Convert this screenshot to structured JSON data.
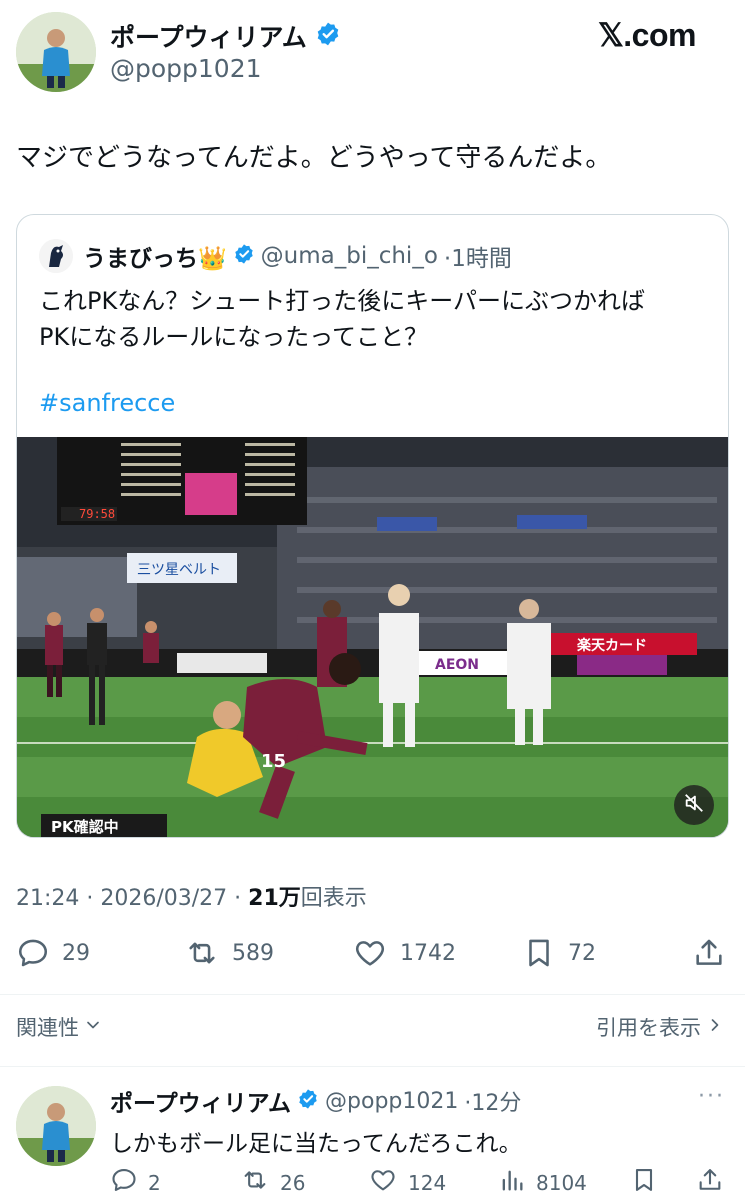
{
  "brand": {
    "site": "𝕏.com"
  },
  "main_tweet": {
    "author_name": "ポープウィリアム",
    "author_handle": "@popp1021",
    "text": "マジでどうなってんだよ。どうやって守るんだよ。",
    "time": "21:24 · 2026/03/27 · ",
    "views_count": "21万",
    "views_label": "回表示"
  },
  "quoted_tweet": {
    "author_name": "うまびっち👑",
    "author_handle": "@uma_bi_chi_o",
    "time": "·1時間",
    "text_line1": "これPKなん？シュート打った後にキーパーにぶつかれば",
    "text_line2": "PKになるルールになったってこと？",
    "hashtag": "#sanfrecce",
    "media": {
      "overlay_label": "PK確認中",
      "scoreboard_time": "79:58",
      "ad_banner": "三ツ星ベルト",
      "ad_right": "楽天カード",
      "ad_aeon": "AEON",
      "player_number": "15"
    }
  },
  "actions": {
    "replies": "29",
    "reposts": "589",
    "likes": "1742",
    "bookmarks": "72"
  },
  "footer_links": {
    "related": "関連性",
    "view_quotes": "引用を表示"
  },
  "reply_tweet": {
    "author_name": "ポープウィリアム",
    "author_handle": "@popp1021",
    "time": "·12分",
    "text": "しかもボール足に当たってんだろこれ。",
    "replies": "2",
    "reposts": "26",
    "likes": "124",
    "views": "8104",
    "more": "···"
  },
  "colors": {
    "text": "#0f1419",
    "secondary": "#536471",
    "accent": "#1d9bf0",
    "border": "#cfd9de"
  },
  "icons": [
    "verified-badge-icon",
    "reply-icon",
    "repost-icon",
    "like-icon",
    "bookmark-icon",
    "share-icon",
    "views-icon",
    "chevron-down-icon",
    "chevron-right-icon",
    "mute-icon",
    "more-icon"
  ]
}
